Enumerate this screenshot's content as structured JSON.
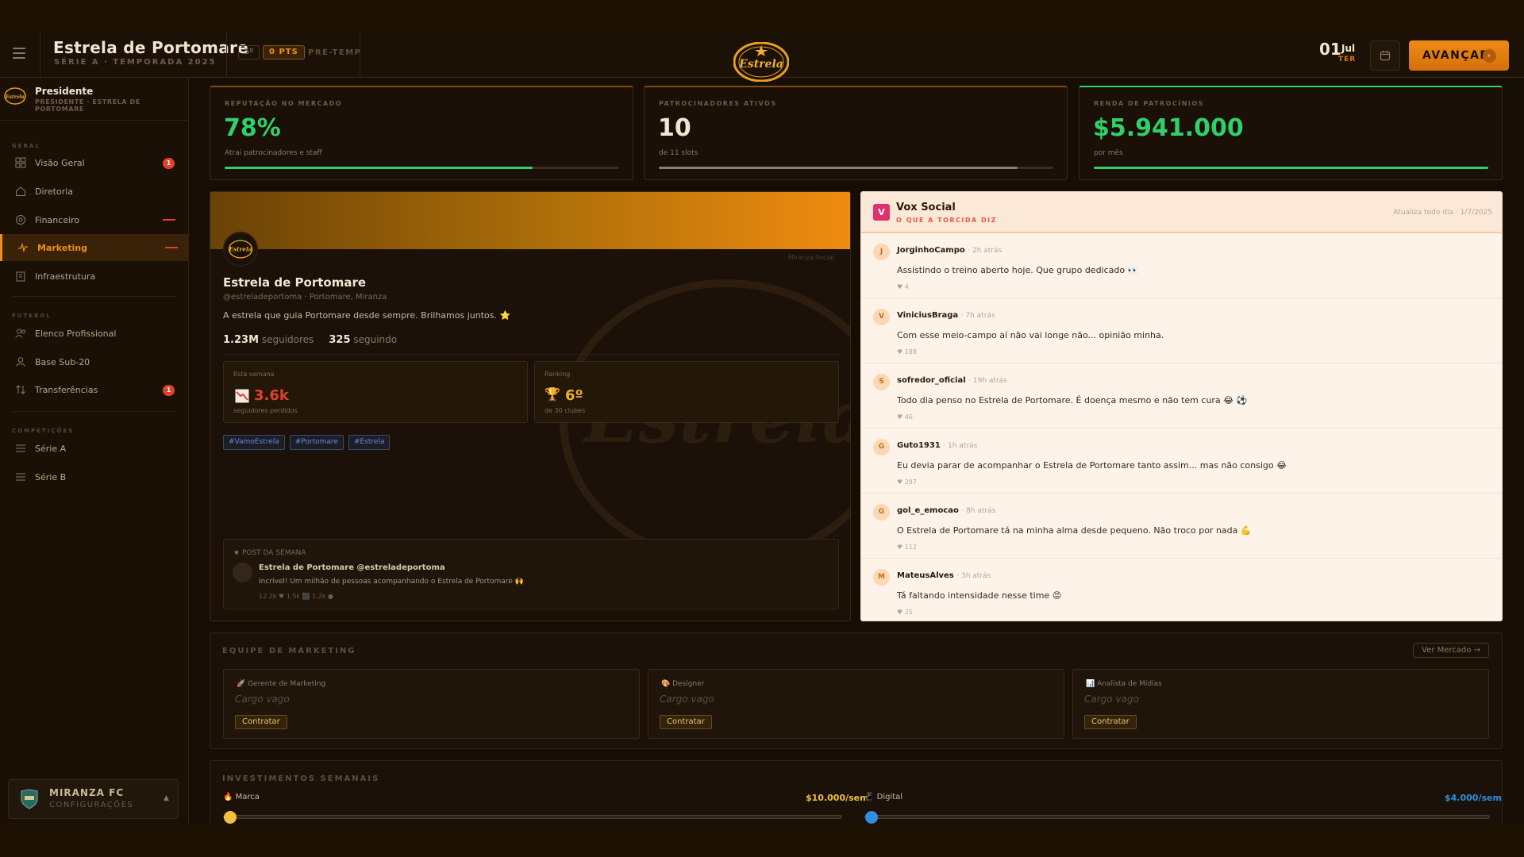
{
  "header": {
    "club_name": "Estrela de Portomare",
    "club_sub": "SÉRIE A · TEMPORADA 2025",
    "position": "5º",
    "points": "0 PTS",
    "phase": "PRÉ-TEMP",
    "date_day_num": "01",
    "date_month": "Jul",
    "date_weekday": "TER",
    "advance_label": "AVANÇAR",
    "logo_text": "Estrela"
  },
  "sidebar": {
    "president_name": "Presidente",
    "president_sub": "PRESIDENTE · ESTRELA DE PORTOMARE",
    "sections": [
      {
        "label": "GERAL"
      },
      {
        "label": "FUTEBOL"
      },
      {
        "label": "COMPETIÇÕES"
      }
    ],
    "items": [
      {
        "label": "Visão Geral",
        "badge": "1"
      },
      {
        "label": "Diretoria"
      },
      {
        "label": "Financeiro"
      },
      {
        "label": "Marketing"
      },
      {
        "label": "Infraestrutura"
      },
      {
        "label": "Elenco Profissional"
      },
      {
        "label": "Base Sub-20"
      },
      {
        "label": "Transferências",
        "badge": "1"
      },
      {
        "label": "Série A"
      },
      {
        "label": "Série B"
      }
    ],
    "club_card": {
      "name": "MIRANZA FC",
      "sub": "CONFIGURAÇÕES"
    }
  },
  "kpis": [
    {
      "label": "REPUTAÇÃO NO MERCADO",
      "value": "78%",
      "sub": "Atrai patrocinadores e staff",
      "fill": 0.78,
      "color": "#2fd06a"
    },
    {
      "label": "PATROCINADORES ATIVOS",
      "value": "10",
      "sub": "de 11 slots",
      "fill": 0.91,
      "color": "#8a8070"
    },
    {
      "label": "RENDA DE PATROCÍNIOS",
      "value": "$5.941.000",
      "sub": "por mês",
      "fill": 1.0,
      "color": "#2fd06a"
    }
  ],
  "profile": {
    "name": "Estrela de Portomare",
    "handle": "@estreladeportoma · Portomare, Miranza",
    "bio": "A estrela que guia Portomare desde sempre. Brilhamos juntos. ⭐",
    "followers": "1.23M",
    "followers_label": "seguidores",
    "following": "325",
    "following_label": "seguindo",
    "network": "Miranza Social",
    "week_label": "Esta semana",
    "week_value": "3.6k",
    "week_sub": "seguidores perdidos",
    "rank_label": "Ranking",
    "rank_value": "6º",
    "rank_sub": "de 30 clubes",
    "tags": [
      "#VamoEstrela",
      "#Portomare",
      "#Estrela"
    ],
    "potw_header": "POST DA SEMANA",
    "potw_author": "Estrela de Portomare @estreladeportoma",
    "potw_text": "Incrível! Um milhão de pessoas acompanhando o Estrela de Portomare 🙌",
    "potw_metrics": "12.2k ♥   1.5k ⬛   1.2k ●"
  },
  "vox": {
    "logo": "V",
    "title": "Vox Social",
    "subtitle": "O QUE A TORCIDA DIZ",
    "updated": "Atualiza todo dia · 1/7/2025",
    "posts": [
      {
        "initial": "J",
        "user": "JorginhoCampo",
        "time": "· 2h atrás",
        "text": "Assistindo o treino aberto hoje. Que grupo dedicado 👀",
        "likes": "♥ 4"
      },
      {
        "initial": "V",
        "user": "ViniciusBraga",
        "time": "· 7h atrás",
        "text": "Com esse meio-campo aí não vai longe não... opinião minha.",
        "likes": "♥ 188"
      },
      {
        "initial": "S",
        "user": "sofredor_oficial",
        "time": "· 19h atrás",
        "text": "Todo dia penso no Estrela de Portomare. É doença mesmo e não tem cura 😂 ⚽",
        "likes": "♥ 46"
      },
      {
        "initial": "G",
        "user": "Guto1931",
        "time": "· 1h atrás",
        "text": "Eu devia parar de acompanhar o Estrela de Portomare tanto assim... mas não consigo 😂",
        "likes": "♥ 297"
      },
      {
        "initial": "G",
        "user": "gol_e_emocao",
        "time": "· 8h atrás",
        "text": "O Estrela de Portomare tá na minha alma desde pequeno. Não troco por nada 💪",
        "likes": "♥ 112"
      },
      {
        "initial": "M",
        "user": "MateusAlves",
        "time": "· 3h atrás",
        "text": "Tá faltando intensidade nesse time 😡",
        "likes": "♥ 25"
      }
    ]
  },
  "team": {
    "label": "EQUIPE DE MARKETING",
    "market_btn": "Ver Mercado →",
    "slots": [
      {
        "title": "🚀 Gerente de Marketing",
        "value": "Cargo vago",
        "hire": "Contratar"
      },
      {
        "title": "🎨 Designer",
        "value": "Cargo vago",
        "hire": "Contratar"
      },
      {
        "title": "📊 Analista de Mídias",
        "value": "Cargo vago",
        "hire": "Contratar"
      }
    ]
  },
  "invest": {
    "label": "INVESTIMENTOS SEMANAIS",
    "items": [
      {
        "name": "🔥 Marca",
        "value": "$10.000/sem",
        "level": 0.0,
        "color": "#f0c040"
      },
      {
        "name": "📱 Digital",
        "value": "$4.000/sem",
        "level": 0.0,
        "color": "#2f8ee0"
      }
    ]
  }
}
